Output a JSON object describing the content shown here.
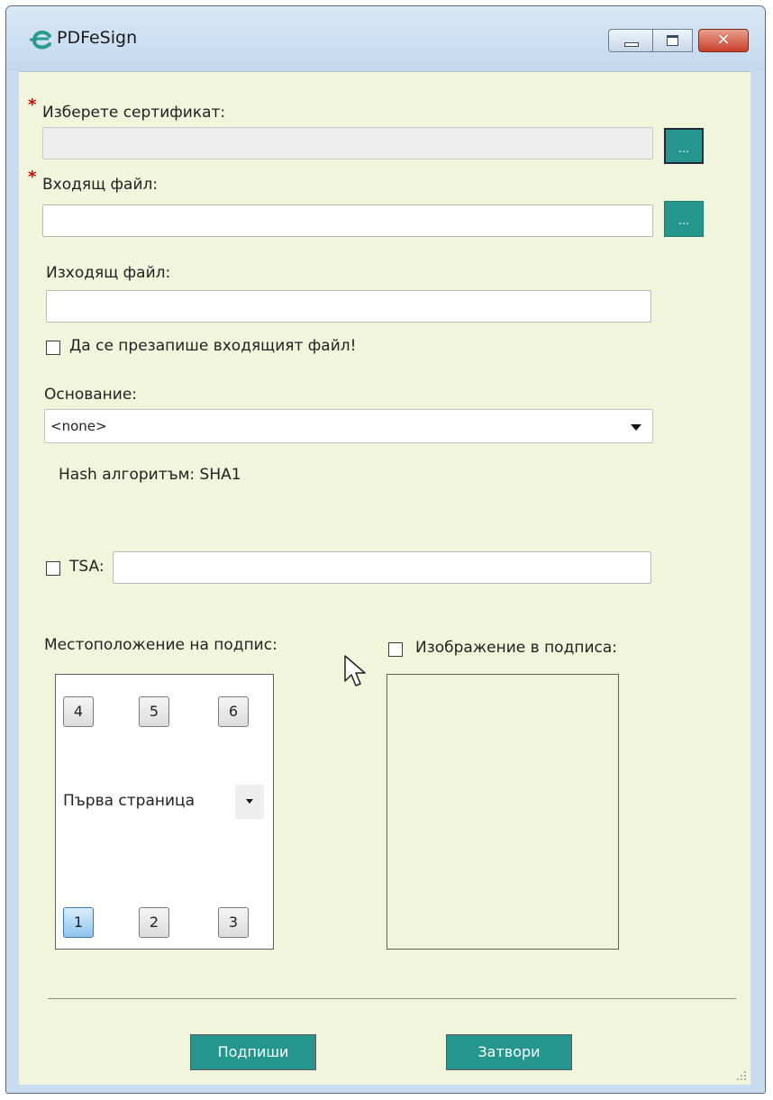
{
  "window": {
    "title": "PDFeSign",
    "colors": {
      "accent": "#25968d",
      "client_bg": "#f1f5dc",
      "required": "#d00000"
    }
  },
  "certificate": {
    "label": "Изберете сертификат:",
    "value": "",
    "browse_label": "..."
  },
  "input_file": {
    "label": "Входящ файл:",
    "value": "",
    "browse_label": "..."
  },
  "output_file": {
    "label": "Изходящ файл:",
    "value": ""
  },
  "overwrite": {
    "label": "Да се презапише входящият файл!",
    "checked": false
  },
  "reason": {
    "label": "Основание:",
    "selected": "<none>"
  },
  "hash": {
    "text": "Hash алгоритъм: SHA1"
  },
  "tsa": {
    "label": "TSA:",
    "checked": false,
    "value": ""
  },
  "signature_position": {
    "label": "Местоположение на подпис:",
    "top_buttons": [
      "4",
      "5",
      "6"
    ],
    "bottom_buttons": [
      "1",
      "2",
      "3"
    ],
    "active": "1",
    "page_selected": "Първа страница"
  },
  "signature_image": {
    "label": "Изображение в подписа:",
    "checked": false
  },
  "actions": {
    "sign_label": "Подпиши",
    "close_label": "Затвори"
  }
}
